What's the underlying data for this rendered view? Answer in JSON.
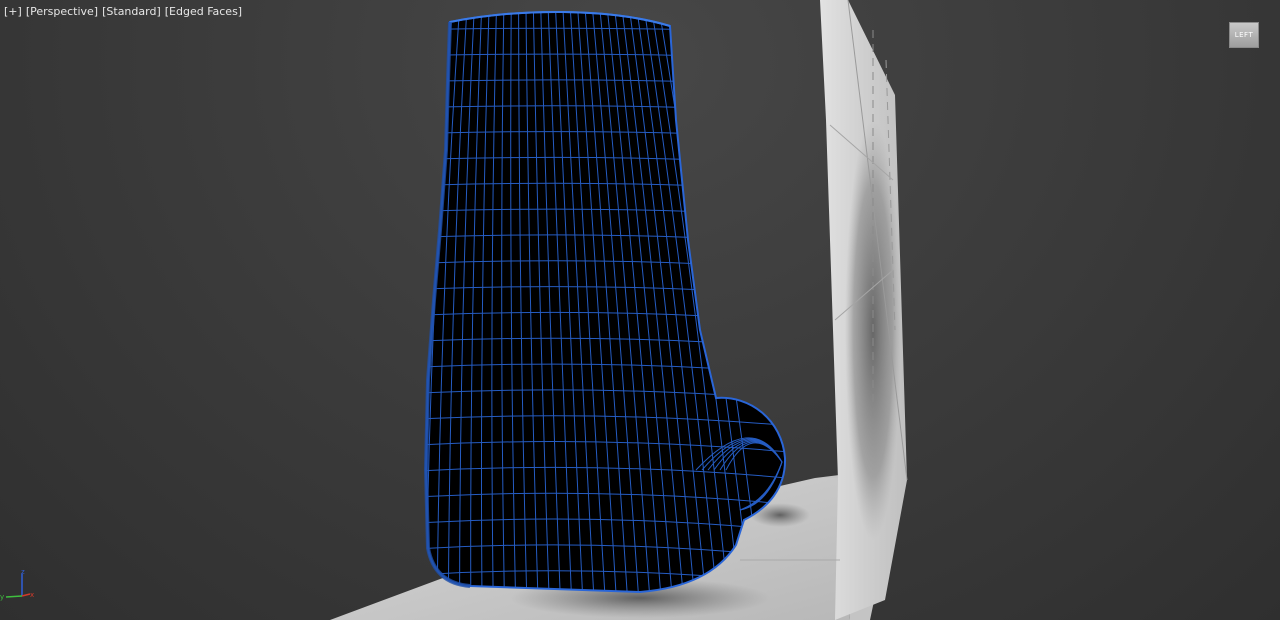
{
  "viewport": {
    "labels": [
      "[+]",
      "[Perspective]",
      "[Standard]",
      "[Edged Faces]"
    ],
    "viewcube_label": "LEFT",
    "axis_labels": {
      "x": "x",
      "y": "y",
      "z": "z"
    }
  },
  "colors": {
    "background": "#3c3c3c",
    "mesh_fill": "#000000",
    "wireframe": "#2a66d8",
    "floor": "#c9c9c9",
    "wall": "#d8d8d8",
    "axis_x": "#d23a2a",
    "axis_y": "#3fbf3f",
    "axis_z": "#2f5fd8"
  },
  "icons": {
    "viewcube": "viewcube-icon",
    "axis_tripod": "axis-tripod-icon"
  }
}
